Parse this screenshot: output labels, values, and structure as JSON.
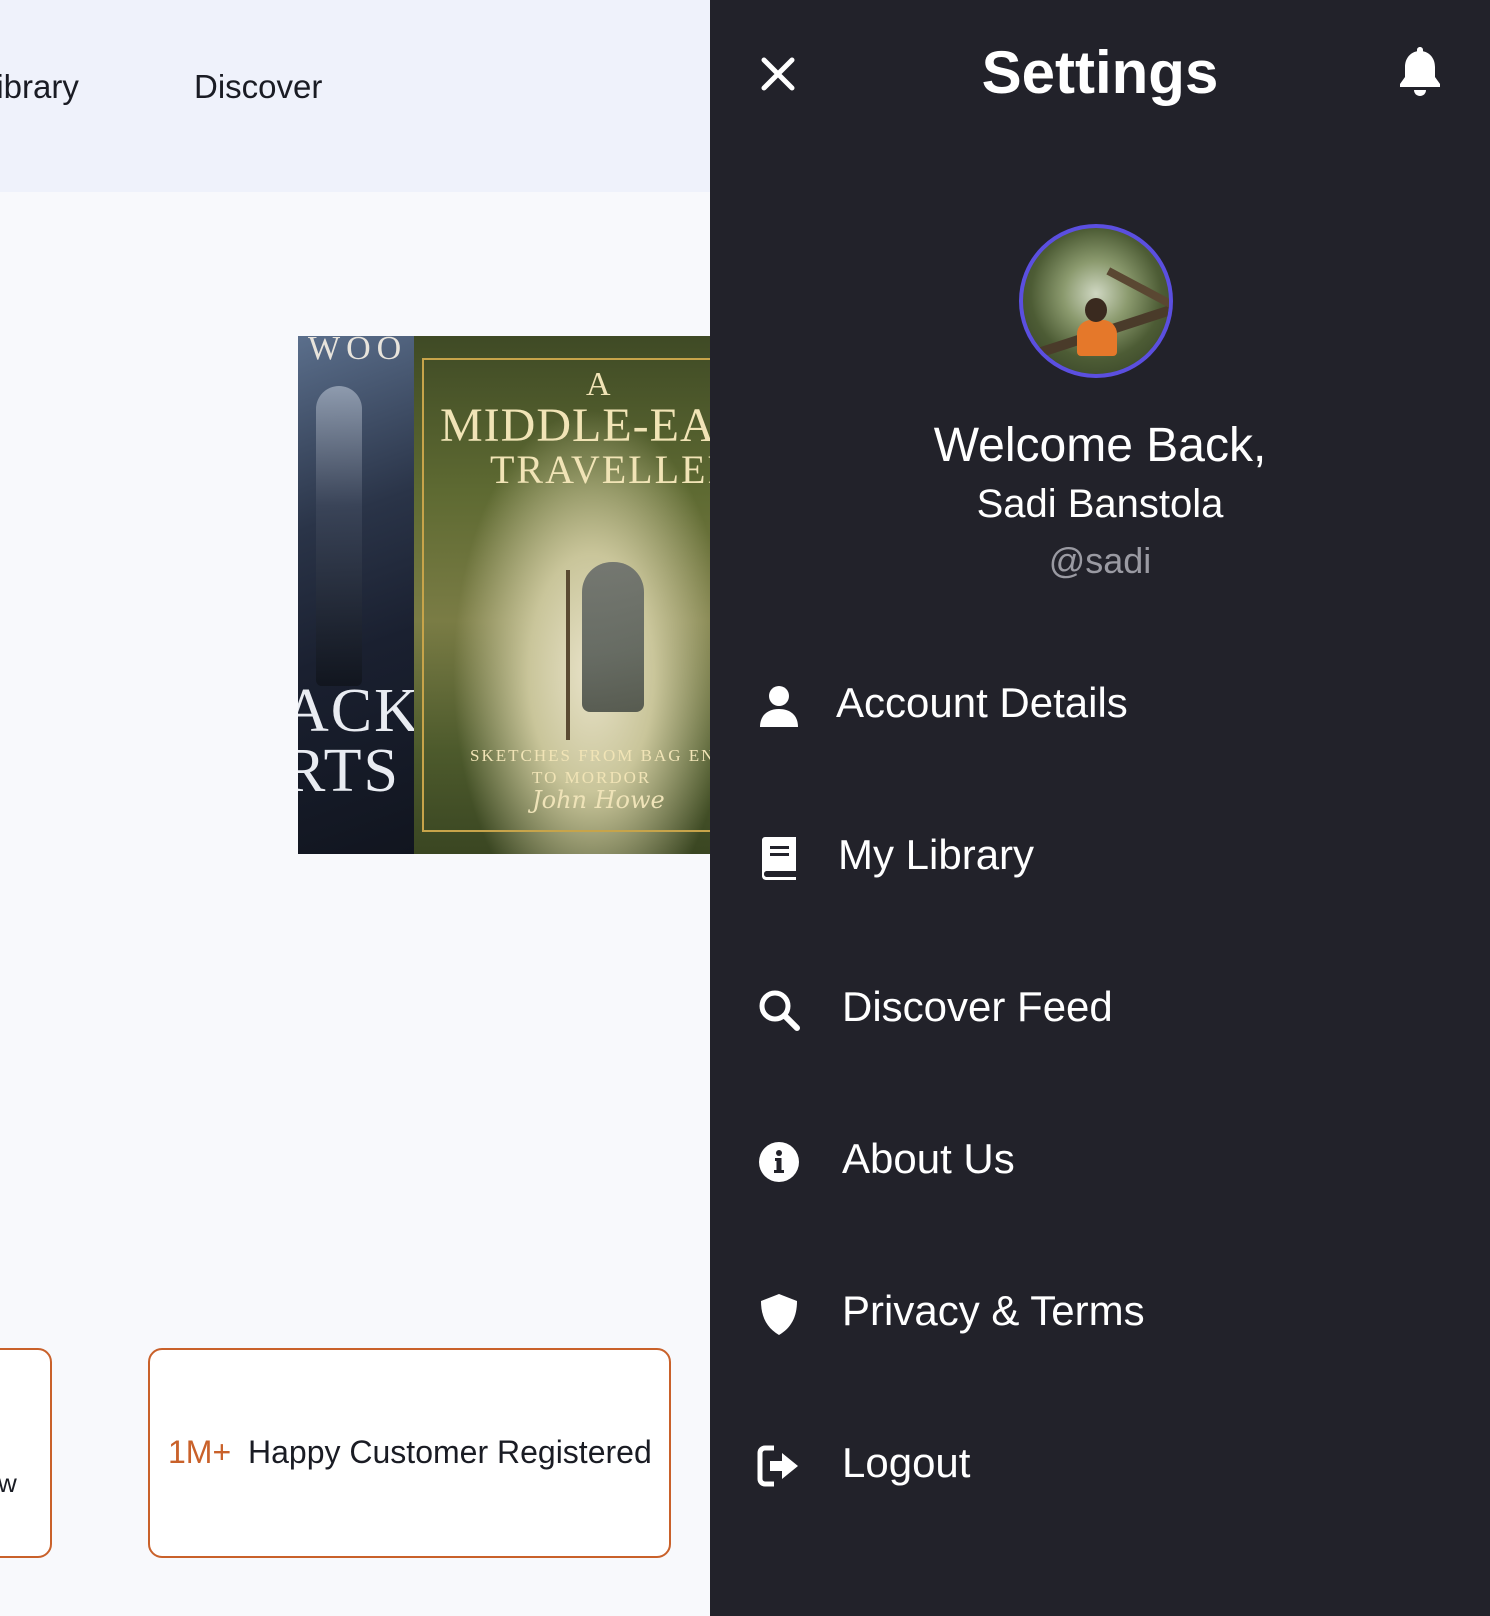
{
  "background_page": {
    "nav": {
      "library_label": "Library",
      "discover_label": "Discover"
    },
    "books": [
      {
        "cover_text_top": "WOO",
        "cover_text_line1": "ACK",
        "cover_text_line2": "RTS"
      },
      {
        "cover_a": "A",
        "cover_title1": "MIDDLE-EART",
        "cover_title2": "TRAVELLER",
        "cover_sub1": "SKETCHES FROM BAG END",
        "cover_sub2": "TO MORDOR",
        "cover_author": "John Howe"
      }
    ],
    "cards": [
      {
        "fragment": "w"
      },
      {
        "stat": "1M+",
        "text": "Happy Customer Registered"
      }
    ],
    "accent_color": "#c9612a"
  },
  "drawer": {
    "title": "Settings",
    "close_icon": "close-icon",
    "bell_icon": "bell-icon",
    "avatar_border_color": "#5b4fe0",
    "welcome": "Welcome Back,",
    "name": "Sadi Banstola",
    "handle": "@sadi",
    "menu": [
      {
        "label": "Account Details",
        "icon": "user-icon"
      },
      {
        "label": "My Library",
        "icon": "book-icon"
      },
      {
        "label": "Discover Feed",
        "icon": "search-icon"
      },
      {
        "label": "About Us",
        "icon": "info-icon"
      },
      {
        "label": "Privacy & Terms",
        "icon": "shield-icon"
      },
      {
        "label": "Logout",
        "icon": "logout-icon"
      }
    ],
    "background_color": "#22222a"
  }
}
